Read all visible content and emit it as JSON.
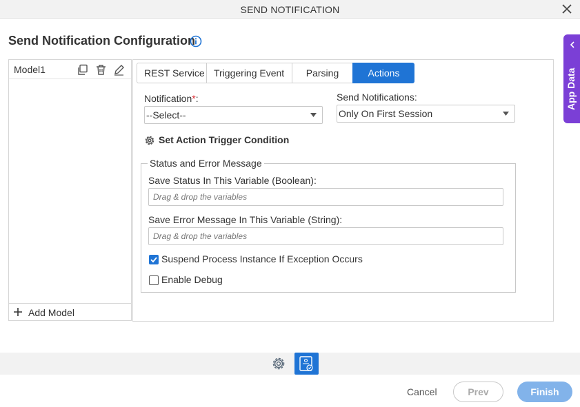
{
  "window": {
    "title": "SEND NOTIFICATION",
    "close_icon": "close-icon"
  },
  "header": {
    "title": "Send Notification Configuration",
    "info_icon": "info-icon"
  },
  "side_tab": {
    "label": "App Data",
    "icon": "chevron-left-icon",
    "color": "#7b3fd6"
  },
  "models": {
    "items": [
      {
        "name": "Model1",
        "icons": [
          "copy-icon",
          "trash-icon",
          "edit-icon"
        ]
      }
    ],
    "add_label": "Add Model"
  },
  "tabs": [
    {
      "label": "REST Service",
      "active": false
    },
    {
      "label": "Triggering Event",
      "active": false
    },
    {
      "label": "Parsing",
      "active": false
    },
    {
      "label": "Actions",
      "active": true
    }
  ],
  "form": {
    "notification": {
      "label": "Notification",
      "required_mark": "*",
      "colon": ":",
      "value": "--Select--"
    },
    "send_notifications": {
      "label": "Send Notifications:",
      "value": "Only On First Session"
    },
    "trigger_label": "Set Action Trigger Condition",
    "status_group": {
      "legend": "Status and Error Message",
      "save_status": {
        "label": "Save Status In This Variable (Boolean):",
        "placeholder": "Drag & drop the variables"
      },
      "save_error": {
        "label": "Save Error Message In This Variable (String):",
        "placeholder": "Drag & drop the variables"
      },
      "suspend": {
        "label": "Suspend Process Instance If Exception Occurs",
        "checked": true
      },
      "debug": {
        "label": "Enable Debug",
        "checked": false
      }
    }
  },
  "footer": {
    "cancel": "Cancel",
    "prev": "Prev",
    "finish": "Finish"
  },
  "colors": {
    "accent": "#1f74d5",
    "finish_disabled": "#82b3ea",
    "required": "#d9262c"
  }
}
